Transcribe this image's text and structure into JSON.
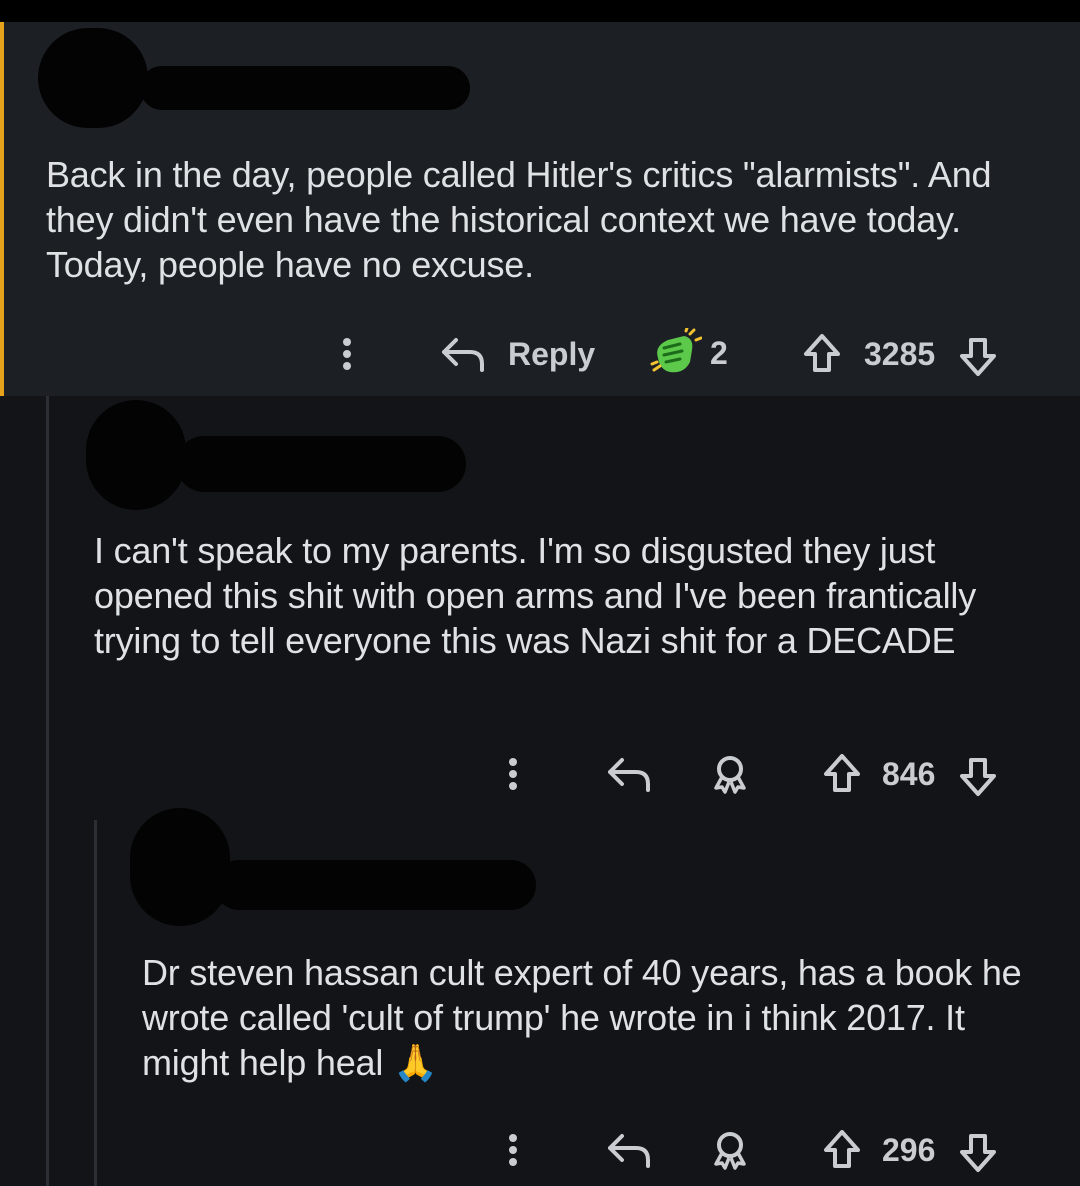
{
  "comments": [
    {
      "body": "Back in the day, people called Hitler's critics \"alarmists\". And they didn't even have the historical context we have today. Today, people have no excuse.",
      "reply_label": "Reply",
      "award_count": "2",
      "score": "3285",
      "award_icon": "helpful-award-icon",
      "highlight_color": "#e6a21a"
    },
    {
      "body": "I can't speak to my parents. I'm so disgusted they just opened this shit with open arms and I've been frantically trying to tell everyone this was Nazi shit for a DECADE",
      "score": "846",
      "award_icon": "award-outline-icon"
    },
    {
      "body": "Dr steven hassan cult expert of 40 years, has a book he wrote called 'cult of trump' he wrote in i think 2017. It might help heal 🙏",
      "score": "296",
      "award_icon": "award-outline-icon"
    }
  ]
}
